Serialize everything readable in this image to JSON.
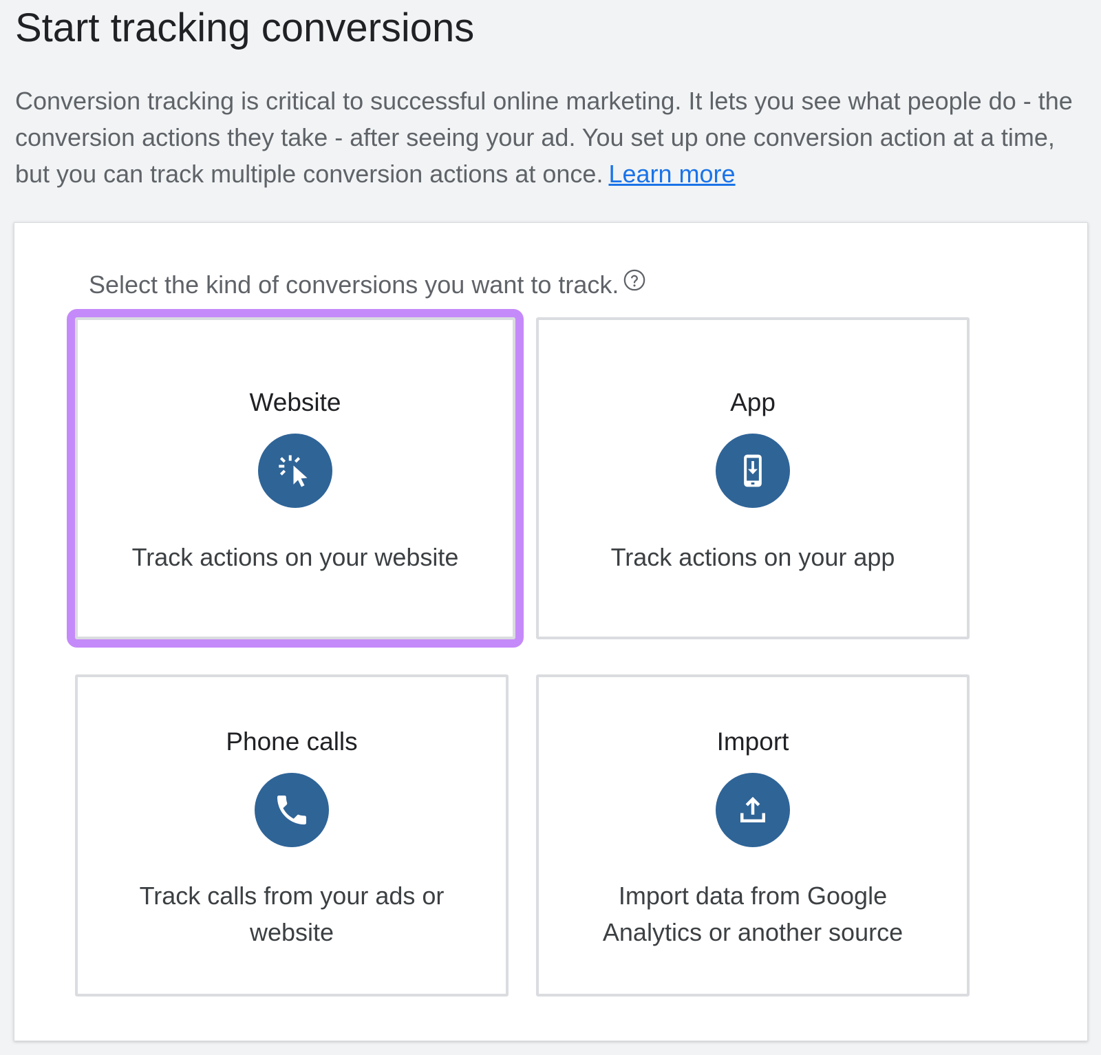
{
  "page": {
    "title": "Start tracking conversions",
    "intro": "Conversion tracking is critical to successful online marketing. It lets you see what people do - the conversion actions they take - after seeing your ad. You set up one conversion action at a time, but you can track multiple conversion actions at once.",
    "learn_more": "Learn more"
  },
  "panel": {
    "prompt": "Select the kind of conversions you want to track.",
    "help_icon": "help-circle-icon",
    "cards": [
      {
        "title": "Website",
        "description": "Track actions on your website",
        "icon": "cursor-click-icon",
        "selected": true
      },
      {
        "title": "App",
        "description": "Track actions on your app",
        "icon": "phone-download-icon",
        "selected": false
      },
      {
        "title": "Phone calls",
        "description": "Track calls from your ads or website",
        "icon": "phone-icon",
        "selected": false
      },
      {
        "title": "Import",
        "description": "Import data from Google Analytics or another source",
        "icon": "upload-icon",
        "selected": false
      }
    ]
  },
  "colors": {
    "background": "#f1f3f4",
    "icon_circle": "#2f6497",
    "selected_outline": "#c58af9",
    "link": "#1a73e8"
  }
}
